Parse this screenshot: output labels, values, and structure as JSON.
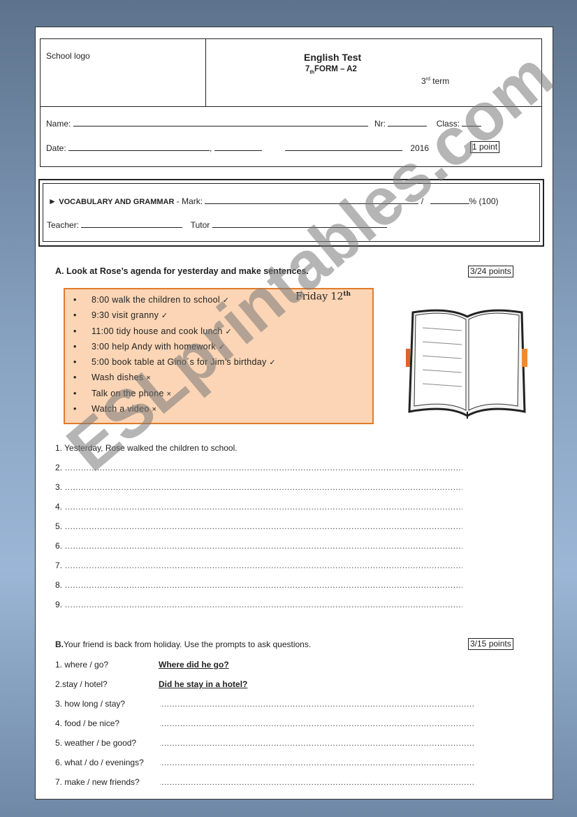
{
  "header": {
    "logo_placeholder": "School logo",
    "title": "English Test",
    "form": "7",
    "form_sub": "th",
    "form_rest": "FORM – A2",
    "term_num": "3",
    "term_sup": "rd",
    "term": " term",
    "name_label": "Name:",
    "nr_label": "Nr:",
    "class_label": "Class:",
    "date_label": "Date:",
    "comma": ",",
    "year": "2016",
    "points": "1 point"
  },
  "marks": {
    "arrow": "►",
    "section": "VOCABULARY AND GRAMMAR",
    "mark_label": "- Mark:",
    "slash": "/",
    "percent": "% (100)",
    "teacher_label": "Teacher:",
    "tutor_label": "Tutor"
  },
  "section_a": {
    "title": "A. Look at Rose’s agenda for yesterday and make sentences.",
    "points": "3/24 points",
    "day": "Friday 12",
    "day_sup": "th",
    "agenda": [
      {
        "text": "8:00 walk the children to school",
        "mark": "✓"
      },
      {
        "text": "9:30 visit granny",
        "mark": "✓"
      },
      {
        "text": "11:00 tidy house and cook lunch",
        "mark": "✓"
      },
      {
        "text": "3:00 help Andy with homework",
        "mark": "✓"
      },
      {
        "text": "5:00 book table at Gino´s for Jim’s birthday",
        "mark": "✓"
      },
      {
        "text": "Wash dishes",
        "mark": "×"
      },
      {
        "text": "Talk on the phone",
        "mark": "×"
      },
      {
        "text": "Watch a video",
        "mark": "×"
      }
    ],
    "example": "1. Yesterday, Rose walked the children to school.",
    "blanks": [
      "2.",
      "3.",
      "4.",
      "5.",
      "6.",
      "7.",
      "8.",
      "9."
    ],
    "dots": "……………………………………………………………………………………………………………………………………………"
  },
  "section_b": {
    "label": "B.",
    "title": "Your friend is back from holiday. Use the prompts to ask questions.",
    "points": "3/15 points",
    "items": [
      {
        "prompt": "1. where / go?",
        "answer": "Where did he go?"
      },
      {
        "prompt": "2.stay / hotel?",
        "answer": "Did he stay in a hotel?"
      },
      {
        "prompt": "3. how long / stay?",
        "answer": ""
      },
      {
        "prompt": "4. food / be nice?",
        "answer": ""
      },
      {
        "prompt": "5. weather / be good?",
        "answer": ""
      },
      {
        "prompt": "6. what / do / evenings?",
        "answer": ""
      },
      {
        "prompt": "7. make / new friends?",
        "answer": ""
      }
    ],
    "dots": "…………………………………………………………………………………………………………?"
  },
  "watermark": "ESLprintables.com"
}
